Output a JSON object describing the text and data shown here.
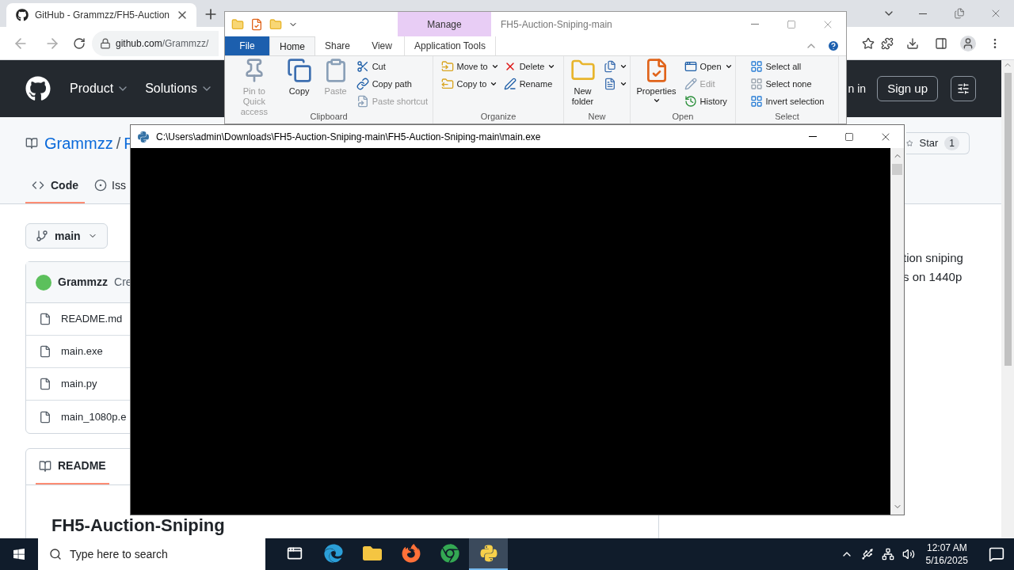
{
  "browser": {
    "tabs": [
      {
        "title": "GitHub - Grammzz/FH5-Auction",
        "selected": true
      }
    ],
    "address": {
      "host": "github.com",
      "path": "/Grammzz/"
    }
  },
  "github": {
    "nav": [
      "Product",
      "Solutions"
    ],
    "sign_in": "n in",
    "sign_up": "Sign up",
    "repo": {
      "owner": "Grammzz",
      "separator": "/",
      "name": "F"
    },
    "tabs": [
      {
        "label": "Code",
        "selected": true
      },
      {
        "label": "Iss",
        "selected": false
      }
    ],
    "star": {
      "label": "Star",
      "count": "1"
    },
    "branch": "main",
    "commit": {
      "author": "Grammzz",
      "message": "Cre"
    },
    "files": [
      "README.md",
      "main.exe",
      "main.py",
      "main_1080p.e"
    ],
    "readme": {
      "tab": "README",
      "heading": "FH5-Auction-Sniping"
    },
    "about_lines": [
      "tion sniping",
      "s on 1440p"
    ]
  },
  "explorer": {
    "title": "FH5-Auction-Sniping-main",
    "context_label": "Manage",
    "tabs": [
      {
        "label": "File",
        "kind": "file",
        "selected": false
      },
      {
        "label": "Home",
        "kind": "tab",
        "selected": true
      },
      {
        "label": "Share",
        "kind": "tab",
        "selected": false
      },
      {
        "label": "View",
        "kind": "tab",
        "selected": false
      },
      {
        "label": "Application Tools",
        "kind": "context",
        "selected": false
      }
    ],
    "groups": [
      {
        "label": "Clipboard",
        "columns": [
          [
            {
              "label": "Pin to Quick access",
              "kind": "large",
              "disabled": true,
              "menu": false
            }
          ],
          [
            {
              "label": "Copy",
              "kind": "large",
              "disabled": false,
              "menu": false
            }
          ],
          [
            {
              "label": "Paste",
              "kind": "large",
              "disabled": true,
              "menu": false
            }
          ],
          [
            {
              "label": "Cut",
              "kind": "small",
              "disabled": false,
              "menu": false
            },
            {
              "label": "Copy path",
              "kind": "small",
              "disabled": false,
              "menu": false
            },
            {
              "label": "Paste shortcut",
              "kind": "small",
              "disabled": true,
              "menu": false
            }
          ]
        ]
      },
      {
        "label": "Organize",
        "columns": [
          [
            {
              "label": "Move to",
              "kind": "small",
              "disabled": false,
              "menu": true
            },
            {
              "label": "Copy to",
              "kind": "small",
              "disabled": false,
              "menu": true
            }
          ],
          [
            {
              "label": "Delete",
              "kind": "small",
              "disabled": false,
              "menu": true
            },
            {
              "label": "Rename",
              "kind": "small",
              "disabled": false,
              "menu": false
            }
          ]
        ]
      },
      {
        "label": "New",
        "columns": [
          [
            {
              "label": "New folder",
              "kind": "large",
              "disabled": false,
              "menu": false
            }
          ],
          [
            {
              "kind": "small",
              "disabled": false,
              "menu": true
            },
            {
              "kind": "small",
              "disabled": false,
              "menu": true
            }
          ]
        ]
      },
      {
        "label": "Open",
        "columns": [
          [
            {
              "label": "Properties",
              "kind": "large",
              "disabled": false,
              "menu": true
            }
          ],
          [
            {
              "label": "Open",
              "kind": "small",
              "disabled": false,
              "menu": true
            },
            {
              "label": "Edit",
              "kind": "small",
              "disabled": true,
              "menu": false
            },
            {
              "label": "History",
              "kind": "small",
              "disabled": false,
              "menu": false
            }
          ]
        ]
      },
      {
        "label": "Select",
        "columns": [
          [
            {
              "label": "Select all",
              "kind": "small",
              "disabled": false,
              "menu": false
            },
            {
              "label": "Select none",
              "kind": "small",
              "disabled": false,
              "menu": false
            },
            {
              "label": "Invert selection",
              "kind": "small",
              "disabled": false,
              "menu": false
            }
          ]
        ]
      }
    ]
  },
  "console": {
    "title": "C:\\Users\\admin\\Downloads\\FH5-Auction-Sniping-main\\FH5-Auction-Sniping-main\\main.exe"
  },
  "taskbar": {
    "search_placeholder": "Type here to search",
    "apps": [
      {
        "kind": "taskview",
        "selected": false
      },
      {
        "kind": "edge",
        "selected": false
      },
      {
        "kind": "explorer",
        "selected": false
      },
      {
        "kind": "firefox",
        "selected": false
      },
      {
        "kind": "chrome",
        "selected": false
      },
      {
        "kind": "python",
        "selected": true
      }
    ],
    "time": "12:07 AM",
    "date": "5/16/2025"
  }
}
